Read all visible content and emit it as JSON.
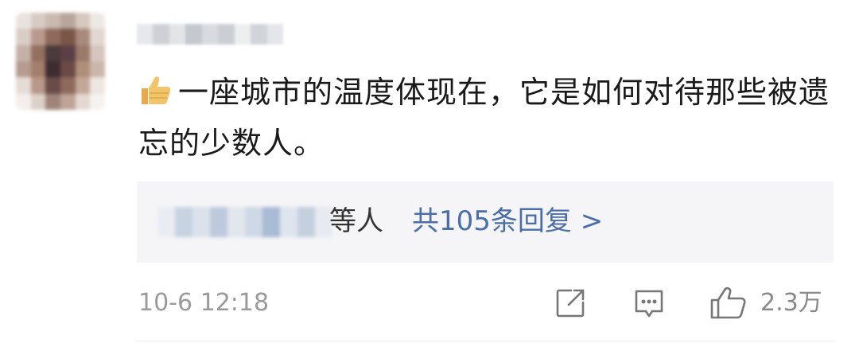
{
  "comment": {
    "emoji": "thumbs-up-icon",
    "text": "一座城市的温度体现在，它是如何对待那些被遗忘的少数人。"
  },
  "replies": {
    "suffix": "等人",
    "link_label": "共105条回复 >"
  },
  "footer": {
    "timestamp": "10-6 12:18",
    "icons": [
      "share-icon",
      "comment-icon",
      "like-icon"
    ],
    "like_count": "2.3万"
  },
  "colors": {
    "link": "#4a6ea8",
    "text": "#1a1a1a",
    "meta": "#9a9a9a",
    "reply_bg": "#f5f5f7"
  }
}
